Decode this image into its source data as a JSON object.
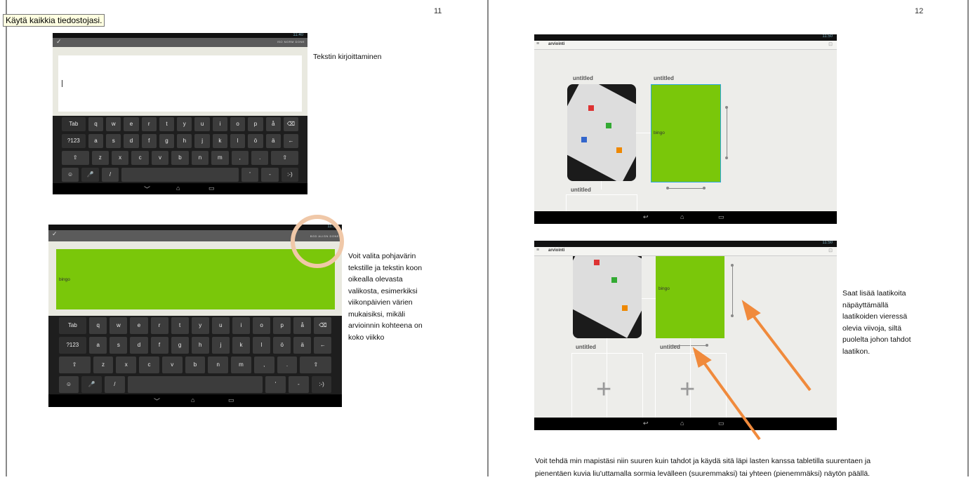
{
  "tooltip": "Käytä kaikkia tiedostojasi.",
  "page_left_number": "11",
  "page_right_number": "12",
  "colors": {
    "accent_green": "#7ac70a",
    "arrow_orange": "#f08a3c",
    "highlight_circle": "#f0c8a8",
    "selection_blue": "#2aa7e0"
  },
  "left": {
    "caption1": "Tekstin kirjoittaminen",
    "caption2_lines": [
      "Voit valita pohjavärin",
      "tekstille ja tekstin koon",
      "oikealla olevasta",
      "valikosta, esimerkiksi",
      "viikonpäivien värien",
      "mukaisiksi, mikäli",
      "arvioinnin kohteena on",
      "koko viikko"
    ],
    "screen1": {
      "status_text": "11:40",
      "actions": "ISO    NORM    DONE",
      "kb_rows": [
        [
          "Tab",
          "q",
          "w",
          "e",
          "r",
          "t",
          "y",
          "u",
          "i",
          "o",
          "p",
          "å",
          "⌫"
        ],
        [
          "?123",
          "a",
          "s",
          "d",
          "f",
          "g",
          "h",
          "j",
          "k",
          "l",
          "ö",
          "ä",
          "←"
        ],
        [
          "⇧",
          "z",
          "x",
          "c",
          "v",
          "b",
          "n",
          "m",
          ",",
          ".",
          "⇧"
        ],
        [
          "☺",
          "🎤",
          "/",
          "",
          "'",
          "-",
          ":-)"
        ]
      ]
    },
    "screen2": {
      "status_text": "11:50",
      "actions": "BGD    ALIGN    DONE",
      "typed_text": "bingo",
      "kb_rows": [
        [
          "Tab",
          "q",
          "w",
          "e",
          "r",
          "t",
          "y",
          "u",
          "i",
          "o",
          "p",
          "å",
          "⌫"
        ],
        [
          "?123",
          "a",
          "s",
          "d",
          "f",
          "g",
          "h",
          "j",
          "k",
          "l",
          "ö",
          "ä",
          "←"
        ],
        [
          "⇧",
          "z",
          "x",
          "c",
          "v",
          "b",
          "n",
          "m",
          ",",
          ".",
          "⇧"
        ],
        [
          "☺",
          "🎤",
          "/",
          "",
          "'",
          "-",
          ":-)"
        ]
      ]
    }
  },
  "right": {
    "screen1": {
      "status_text": "11:50",
      "app_title": "arviointi",
      "label_a": "untitled",
      "label_b": "untitled",
      "label_c": "untitled",
      "card_text": "bingo"
    },
    "screen2": {
      "status_text": "11:50",
      "app_title": "arviointi",
      "label_a": "untitled",
      "label_b": "untitled",
      "card_text": "bingo"
    },
    "caption_lines": [
      "Saat lisää laatikoita",
      "näpäyttämällä",
      "laatikoiden vieressä",
      "olevia viivoja, siltä",
      "puolelta johon tahdot",
      "laatikon."
    ],
    "bottom_lines": [
      "Voit tehdä min mapistäsi niin suuren kuin tahdot ja käydä sitä läpi lasten kanssa tabletilla suurentaen ja",
      "pienentäen kuvia liu'uttamalla sormia levälleen (suuremmaksi) tai yhteen (pienemmäksi) näytön päällä."
    ]
  }
}
